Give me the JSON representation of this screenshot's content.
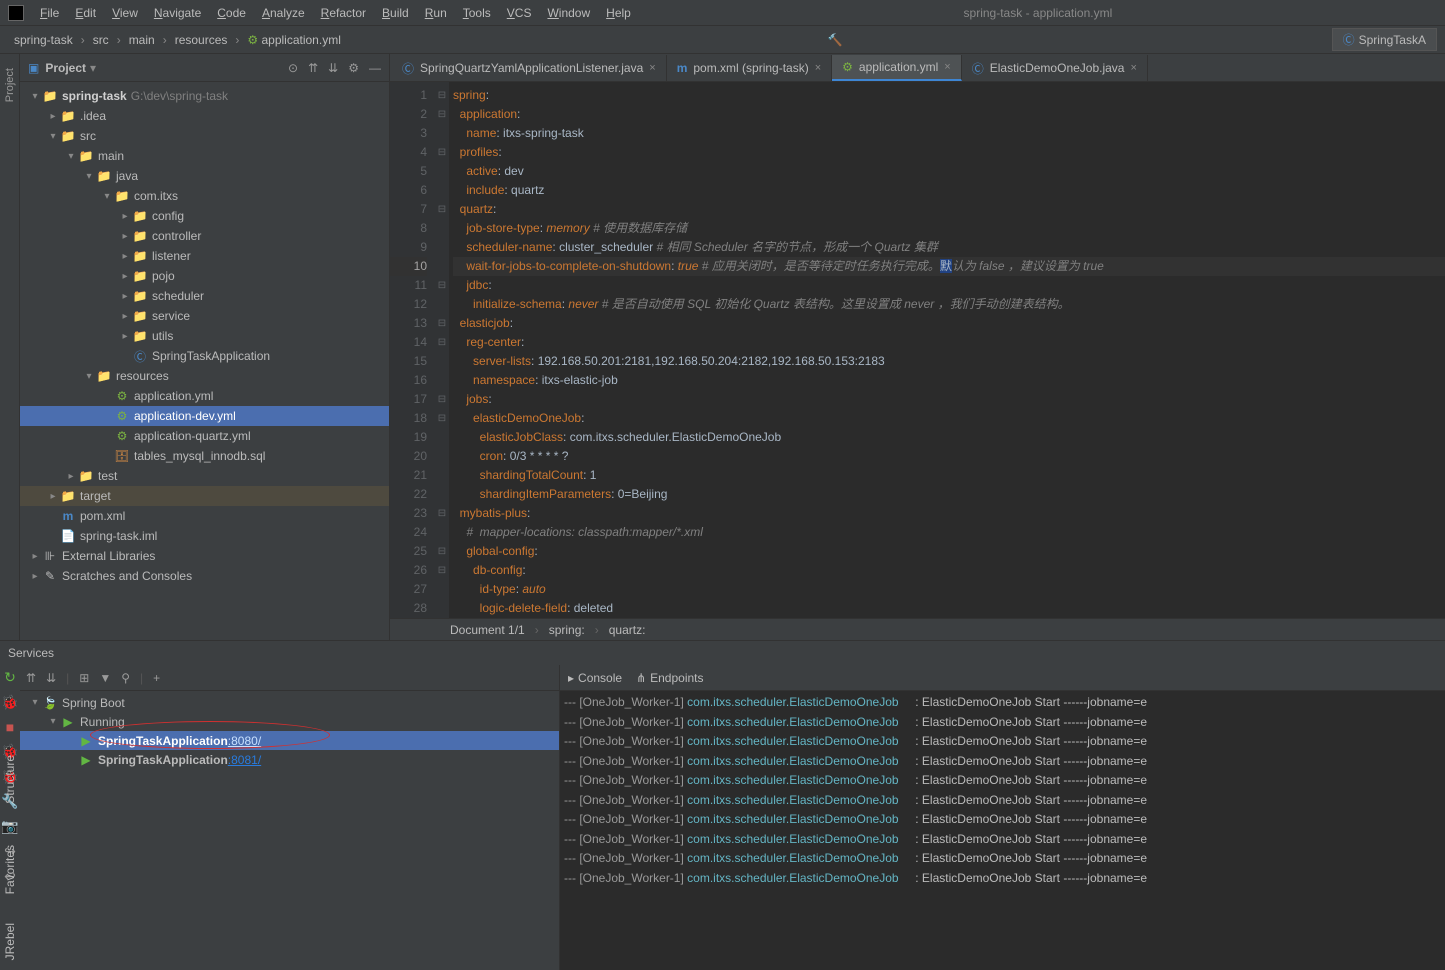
{
  "window_title": "spring-task - application.yml",
  "menu": [
    "File",
    "Edit",
    "View",
    "Navigate",
    "Code",
    "Analyze",
    "Refactor",
    "Build",
    "Run",
    "Tools",
    "VCS",
    "Window",
    "Help"
  ],
  "breadcrumbs": [
    "spring-task",
    "src",
    "main",
    "resources",
    "application.yml"
  ],
  "right_nav_button": "SpringTaskA",
  "project_panel_title": "Project",
  "left_strip": {
    "project": "Project",
    "structure": "Structure",
    "favorites": "Favorites",
    "jrebel": "JRebel"
  },
  "tree": [
    {
      "d": 0,
      "arrow": "▾",
      "icon": "📁",
      "iconCls": "icon-mod",
      "label": "spring-task",
      "bold": true,
      "dim": "G:\\dev\\spring-task"
    },
    {
      "d": 1,
      "arrow": "▸",
      "icon": "📁",
      "iconCls": "icon-folder",
      "label": ".idea"
    },
    {
      "d": 1,
      "arrow": "▾",
      "icon": "📁",
      "iconCls": "icon-mod",
      "label": "src"
    },
    {
      "d": 2,
      "arrow": "▾",
      "icon": "📁",
      "iconCls": "icon-mod",
      "label": "main"
    },
    {
      "d": 3,
      "arrow": "▾",
      "icon": "📁",
      "iconCls": "icon-mod",
      "label": "java"
    },
    {
      "d": 4,
      "arrow": "▾",
      "icon": "📁",
      "iconCls": "icon-folder",
      "label": "com.itxs"
    },
    {
      "d": 5,
      "arrow": "▸",
      "icon": "📁",
      "iconCls": "icon-folder",
      "label": "config"
    },
    {
      "d": 5,
      "arrow": "▸",
      "icon": "📁",
      "iconCls": "icon-folder",
      "label": "controller"
    },
    {
      "d": 5,
      "arrow": "▸",
      "icon": "📁",
      "iconCls": "icon-folder",
      "label": "listener"
    },
    {
      "d": 5,
      "arrow": "▸",
      "icon": "📁",
      "iconCls": "icon-folder",
      "label": "pojo"
    },
    {
      "d": 5,
      "arrow": "▸",
      "icon": "📁",
      "iconCls": "icon-folder",
      "label": "scheduler"
    },
    {
      "d": 5,
      "arrow": "▸",
      "icon": "📁",
      "iconCls": "icon-folder",
      "label": "service"
    },
    {
      "d": 5,
      "arrow": "▸",
      "icon": "📁",
      "iconCls": "icon-folder",
      "label": "utils"
    },
    {
      "d": 5,
      "arrow": "",
      "icon": "Ⓒ",
      "iconCls": "icon-java",
      "label": "SpringTaskApplication"
    },
    {
      "d": 3,
      "arrow": "▾",
      "icon": "📁",
      "iconCls": "icon-mod",
      "label": "resources"
    },
    {
      "d": 4,
      "arrow": "",
      "icon": "⚙",
      "iconCls": "icon-yml",
      "label": "application.yml"
    },
    {
      "d": 4,
      "arrow": "",
      "icon": "⚙",
      "iconCls": "icon-yml",
      "label": "application-dev.yml",
      "selected": true
    },
    {
      "d": 4,
      "arrow": "",
      "icon": "⚙",
      "iconCls": "icon-yml",
      "label": "application-quartz.yml"
    },
    {
      "d": 4,
      "arrow": "",
      "icon": "🗄",
      "iconCls": "icon-db",
      "label": "tables_mysql_innodb.sql"
    },
    {
      "d": 2,
      "arrow": "▸",
      "icon": "📁",
      "iconCls": "icon-folder",
      "label": "test"
    },
    {
      "d": 1,
      "arrow": "▸",
      "icon": "📁",
      "iconCls": "icon-folder",
      "label": "target",
      "hl": true
    },
    {
      "d": 1,
      "arrow": "",
      "icon": "m",
      "iconCls": "icon-m",
      "label": "pom.xml"
    },
    {
      "d": 1,
      "arrow": "",
      "icon": "📄",
      "iconCls": "",
      "label": "spring-task.iml"
    },
    {
      "d": 0,
      "arrow": "▸",
      "icon": "⊪",
      "iconCls": "",
      "label": "External Libraries"
    },
    {
      "d": 0,
      "arrow": "▸",
      "icon": "✎",
      "iconCls": "",
      "label": "Scratches and Consoles"
    }
  ],
  "tabs": [
    {
      "icon": "Ⓒ",
      "label": "SpringQuartzYamlApplicationListener.java",
      "close": true
    },
    {
      "icon": "m",
      "label": "pom.xml (spring-task)",
      "close": true
    },
    {
      "icon": "⚙",
      "label": "application.yml",
      "close": true,
      "active": true
    },
    {
      "icon": "Ⓒ",
      "label": "ElasticDemoOneJob.java",
      "close": true
    }
  ],
  "status_bar": {
    "doc": "Document 1/1",
    "crumbs": [
      "spring:",
      "quartz:"
    ]
  },
  "code": {
    "lines": [
      {
        "n": 1,
        "fold": "⊟",
        "seg": [
          [
            "spring",
            "k"
          ],
          [
            ":",
            "p"
          ]
        ]
      },
      {
        "n": 2,
        "fold": "⊟",
        "seg": [
          [
            "  ",
            ""
          ],
          [
            "application",
            "k"
          ],
          [
            ":",
            "p"
          ]
        ]
      },
      {
        "n": 3,
        "fold": "",
        "seg": [
          [
            "    ",
            ""
          ],
          [
            "name",
            "k"
          ],
          [
            ": ",
            "p"
          ],
          [
            "itxs-spring-task",
            "s"
          ]
        ]
      },
      {
        "n": 4,
        "fold": "⊟",
        "seg": [
          [
            "  ",
            ""
          ],
          [
            "profiles",
            "k"
          ],
          [
            ":",
            "p"
          ]
        ]
      },
      {
        "n": 5,
        "fold": "",
        "seg": [
          [
            "    ",
            ""
          ],
          [
            "active",
            "k"
          ],
          [
            ": ",
            "p"
          ],
          [
            "dev",
            "s"
          ]
        ]
      },
      {
        "n": 6,
        "fold": "",
        "seg": [
          [
            "    ",
            ""
          ],
          [
            "include",
            "k"
          ],
          [
            ": ",
            "p"
          ],
          [
            "quartz",
            "s"
          ]
        ]
      },
      {
        "n": 7,
        "fold": "⊟",
        "seg": [
          [
            "  ",
            ""
          ],
          [
            "quartz",
            "k"
          ],
          [
            ":",
            "p"
          ]
        ]
      },
      {
        "n": 8,
        "fold": "",
        "seg": [
          [
            "    ",
            ""
          ],
          [
            "job-store-type",
            "k"
          ],
          [
            ": ",
            "p"
          ],
          [
            "memory",
            "i"
          ],
          [
            " ",
            ""
          ],
          [
            "# 使用数据库存储",
            "c"
          ]
        ]
      },
      {
        "n": 9,
        "fold": "",
        "seg": [
          [
            "    ",
            ""
          ],
          [
            "scheduler-name",
            "k"
          ],
          [
            ": ",
            "p"
          ],
          [
            "cluster_scheduler",
            "s"
          ],
          [
            " ",
            ""
          ],
          [
            "# 相同 Scheduler 名字的节点，形成一个 Quartz 集群",
            "c"
          ]
        ]
      },
      {
        "n": 10,
        "fold": "",
        "hl": true,
        "seg": [
          [
            "    ",
            ""
          ],
          [
            "wait-for-jobs-to-complete-on-shutdown",
            "k"
          ],
          [
            ": ",
            "p"
          ],
          [
            "true",
            "i"
          ],
          [
            " ",
            ""
          ],
          [
            "# 应用关闭时，是否等待定时任务执行完成。",
            "c"
          ],
          [
            "默",
            "sel"
          ],
          [
            "认为 false ，建议设置为 true",
            "c"
          ]
        ]
      },
      {
        "n": 11,
        "fold": "⊟",
        "seg": [
          [
            "    ",
            ""
          ],
          [
            "jdbc",
            "k"
          ],
          [
            ":",
            "p"
          ]
        ]
      },
      {
        "n": 12,
        "fold": "",
        "seg": [
          [
            "      ",
            ""
          ],
          [
            "initialize-schema",
            "k"
          ],
          [
            ": ",
            "p"
          ],
          [
            "never",
            "i"
          ],
          [
            " ",
            ""
          ],
          [
            "# 是否自动使用 SQL 初始化 Quartz 表结构。这里设置成 never ，我们手动创建表结构。",
            "c"
          ]
        ]
      },
      {
        "n": 13,
        "fold": "⊟",
        "seg": [
          [
            "  ",
            ""
          ],
          [
            "elasticjob",
            "k"
          ],
          [
            ":",
            "p"
          ]
        ]
      },
      {
        "n": 14,
        "fold": "⊟",
        "seg": [
          [
            "    ",
            ""
          ],
          [
            "reg-center",
            "k"
          ],
          [
            ":",
            "p"
          ]
        ]
      },
      {
        "n": 15,
        "fold": "",
        "seg": [
          [
            "      ",
            ""
          ],
          [
            "server-lists",
            "k"
          ],
          [
            ": ",
            "p"
          ],
          [
            "192.168.50.201:2181,192.168.50.204:2182,192.168.50.153:2183",
            "s"
          ]
        ]
      },
      {
        "n": 16,
        "fold": "",
        "seg": [
          [
            "      ",
            ""
          ],
          [
            "namespace",
            "k"
          ],
          [
            ": ",
            "p"
          ],
          [
            "itxs-elastic-job",
            "s"
          ]
        ]
      },
      {
        "n": 17,
        "fold": "⊟",
        "seg": [
          [
            "    ",
            ""
          ],
          [
            "jobs",
            "k"
          ],
          [
            ":",
            "p"
          ]
        ]
      },
      {
        "n": 18,
        "fold": "⊟",
        "seg": [
          [
            "      ",
            ""
          ],
          [
            "elasticDemoOneJob",
            "k"
          ],
          [
            ":",
            "p"
          ]
        ]
      },
      {
        "n": 19,
        "fold": "",
        "seg": [
          [
            "        ",
            ""
          ],
          [
            "elasticJobClass",
            "k"
          ],
          [
            ": ",
            "p"
          ],
          [
            "com.itxs.scheduler.ElasticDemoOneJob",
            "s"
          ]
        ]
      },
      {
        "n": 20,
        "fold": "",
        "seg": [
          [
            "        ",
            ""
          ],
          [
            "cron",
            "k"
          ],
          [
            ": ",
            "p"
          ],
          [
            "0/3 * * * * ?",
            "s"
          ]
        ]
      },
      {
        "n": 21,
        "fold": "",
        "seg": [
          [
            "        ",
            ""
          ],
          [
            "shardingTotalCount",
            "k"
          ],
          [
            ": ",
            "p"
          ],
          [
            "1",
            "s"
          ]
        ]
      },
      {
        "n": 22,
        "fold": "",
        "seg": [
          [
            "        ",
            ""
          ],
          [
            "shardingItemParameters",
            "k"
          ],
          [
            ": ",
            "p"
          ],
          [
            "0=Beijing",
            "s"
          ]
        ]
      },
      {
        "n": 23,
        "fold": "⊟",
        "seg": [
          [
            "  ",
            ""
          ],
          [
            "mybatis-plus",
            "k"
          ],
          [
            ":",
            "p"
          ]
        ]
      },
      {
        "n": 24,
        "fold": "",
        "seg": [
          [
            "    ",
            ""
          ],
          [
            "#  mapper-locations: classpath:mapper/*.xml",
            "c"
          ]
        ]
      },
      {
        "n": 25,
        "fold": "⊟",
        "seg": [
          [
            "    ",
            ""
          ],
          [
            "global-config",
            "k"
          ],
          [
            ":",
            "p"
          ]
        ]
      },
      {
        "n": 26,
        "fold": "⊟",
        "seg": [
          [
            "      ",
            ""
          ],
          [
            "db-config",
            "k"
          ],
          [
            ":",
            "p"
          ]
        ]
      },
      {
        "n": 27,
        "fold": "",
        "seg": [
          [
            "        ",
            ""
          ],
          [
            "id-type",
            "k"
          ],
          [
            ": ",
            "p"
          ],
          [
            "auto",
            "i"
          ]
        ]
      },
      {
        "n": 28,
        "fold": "",
        "seg": [
          [
            "        ",
            ""
          ],
          [
            "logic-delete-field",
            "k"
          ],
          [
            ": ",
            "p"
          ],
          [
            "deleted",
            "s"
          ]
        ]
      }
    ]
  },
  "services": {
    "title": "Services",
    "tree": [
      {
        "d": 0,
        "arrow": "▾",
        "icon": "🍃",
        "iconCls": "icon-sb",
        "label": "Spring Boot"
      },
      {
        "d": 1,
        "arrow": "▾",
        "icon": "▶",
        "iconCls": "icon-run",
        "label": "Running"
      },
      {
        "d": 2,
        "arrow": "",
        "icon": "▶",
        "iconCls": "icon-run",
        "label": "SpringTaskApplication",
        "bold": true,
        "port": ":8080/",
        "selected": true
      },
      {
        "d": 2,
        "arrow": "",
        "icon": "▶",
        "iconCls": "icon-run",
        "label": "SpringTaskApplication",
        "bold": true,
        "port": ":8081/"
      }
    ],
    "console_tabs": [
      {
        "icon": "▸",
        "label": "Console"
      },
      {
        "icon": "⋔",
        "label": "Endpoints"
      }
    ],
    "console_lines": [
      "--- [OneJob_Worker-1] com.itxs.scheduler.ElasticDemoOneJob     : ElasticDemoOneJob Start ------jobname=e",
      "--- [OneJob_Worker-1] com.itxs.scheduler.ElasticDemoOneJob     : ElasticDemoOneJob Start ------jobname=e",
      "--- [OneJob_Worker-1] com.itxs.scheduler.ElasticDemoOneJob     : ElasticDemoOneJob Start ------jobname=e",
      "--- [OneJob_Worker-1] com.itxs.scheduler.ElasticDemoOneJob     : ElasticDemoOneJob Start ------jobname=e",
      "--- [OneJob_Worker-1] com.itxs.scheduler.ElasticDemoOneJob     : ElasticDemoOneJob Start ------jobname=e",
      "--- [OneJob_Worker-1] com.itxs.scheduler.ElasticDemoOneJob     : ElasticDemoOneJob Start ------jobname=e",
      "--- [OneJob_Worker-1] com.itxs.scheduler.ElasticDemoOneJob     : ElasticDemoOneJob Start ------jobname=e",
      "--- [OneJob_Worker-1] com.itxs.scheduler.ElasticDemoOneJob     : ElasticDemoOneJob Start ------jobname=e",
      "--- [OneJob_Worker-1] com.itxs.scheduler.ElasticDemoOneJob     : ElasticDemoOneJob Start ------jobname=e",
      "--- [OneJob_Worker-1] com.itxs.scheduler.ElasticDemoOneJob     : ElasticDemoOneJob Start ------jobname=e"
    ]
  }
}
